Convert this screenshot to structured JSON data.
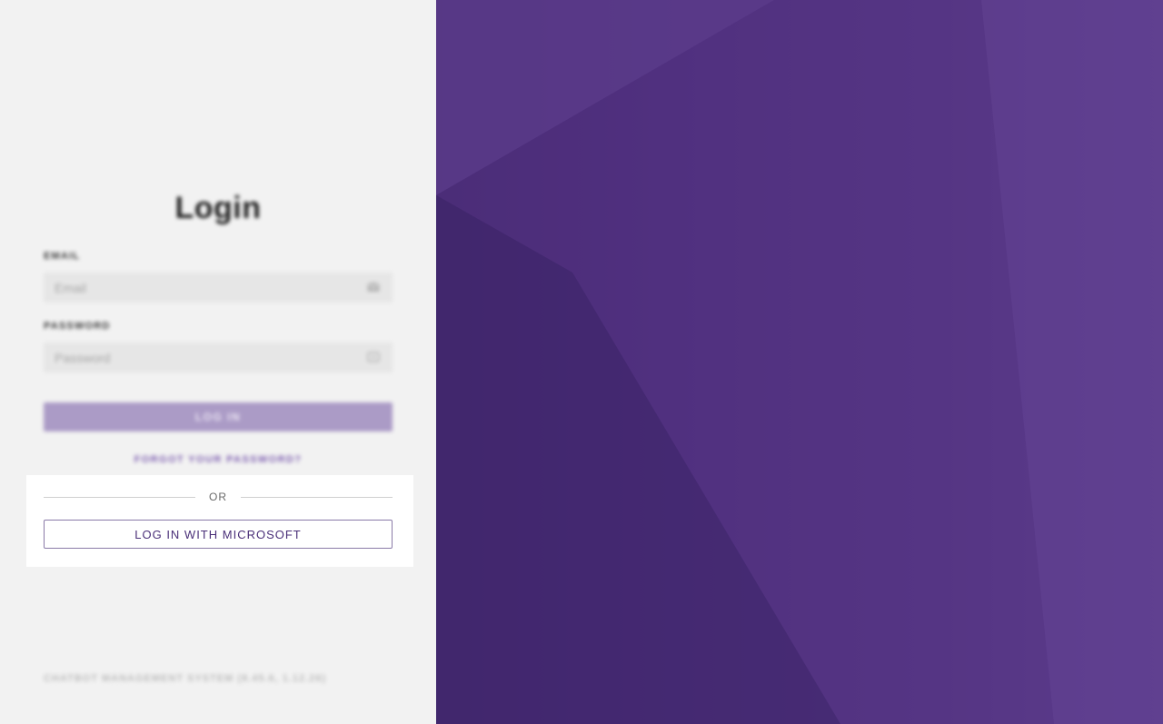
{
  "login": {
    "title": "Login",
    "email_label": "EMAIL",
    "email_placeholder": "Email",
    "email_icon": "envelope-icon",
    "password_label": "PASSWORD",
    "password_placeholder": "Password",
    "password_icon": "lock-icon",
    "submit_label": "LOG IN",
    "forgot_label": "FORGOT YOUR PASSWORD?"
  },
  "sso": {
    "divider_text": "OR",
    "microsoft_label": "LOG IN WITH MICROSOFT"
  },
  "footer": {
    "version": "CHATBOT MANAGEMENT SYSTEM (8.45.6, 1.12.26)"
  },
  "colors": {
    "brand": "#4e2f7e",
    "button_disabled": "#ab9bc6",
    "link": "#7e5fb0",
    "panel_bg": "#f2f2f2"
  }
}
